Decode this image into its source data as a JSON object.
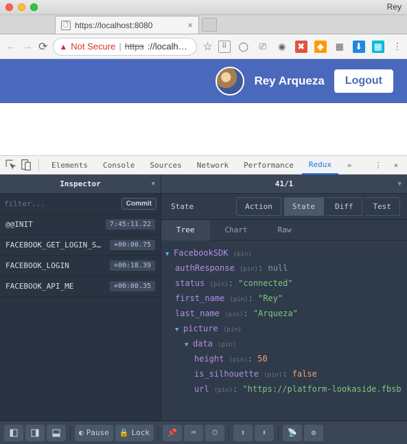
{
  "browser": {
    "profile_name": "Rey",
    "tab_title": "https://localhost:8080",
    "not_secure": "Not Secure",
    "https": "https",
    "url_rest": "://localh…",
    "star_icon": "☆"
  },
  "page": {
    "username": "Rey Arqueza",
    "logout": "Logout"
  },
  "devtools": {
    "tabs": {
      "elements": "Elements",
      "console": "Console",
      "sources": "Sources",
      "network": "Network",
      "performance": "Performance",
      "redux": "Redux"
    }
  },
  "redux": {
    "inspector_label": "Inspector",
    "counter": "41/1",
    "filter_placeholder": "filter...",
    "commit": "Commit",
    "actions": [
      {
        "name": "@@INIT",
        "time": "7:45:11.22"
      },
      {
        "name": "FACEBOOK_GET_LOGIN_S…",
        "time": "+00:00.75"
      },
      {
        "name": "FACEBOOK_LOGIN",
        "time": "+00:18.39"
      },
      {
        "name": "FACEBOOK_API_ME",
        "time": "+00:00.35"
      }
    ],
    "panel_label": "State",
    "tabs1": {
      "action": "Action",
      "state": "State",
      "diff": "Diff",
      "test": "Test"
    },
    "tabs2": {
      "tree": "Tree",
      "chart": "Chart",
      "raw": "Raw"
    },
    "tree": {
      "root": "FacebookSDK",
      "authResponse": {
        "key": "authResponse",
        "val": "null"
      },
      "status": {
        "key": "status",
        "val": "\"connected\""
      },
      "first_name": {
        "key": "first_name",
        "val": "\"Rey\""
      },
      "last_name": {
        "key": "last_name",
        "val": "\"Arqueza\""
      },
      "picture": "picture",
      "data": "data",
      "height": {
        "key": "height",
        "val": "50"
      },
      "is_silhouette": {
        "key": "is_silhouette",
        "val": "false"
      },
      "url": {
        "key": "url",
        "val": "\"https://platform-lookaside.fbsb"
      },
      "pin": "(pin)"
    },
    "footer": {
      "pause": "Pause",
      "lock": "Lock"
    }
  }
}
